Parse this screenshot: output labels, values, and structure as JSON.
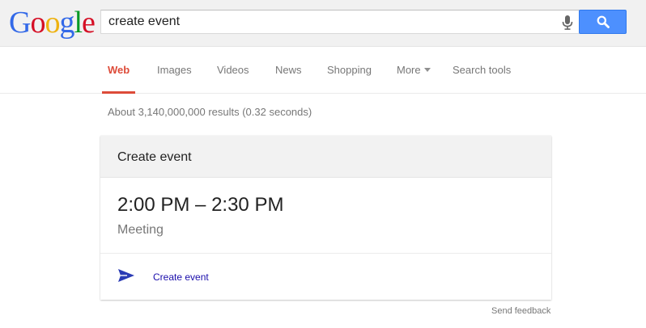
{
  "header": {
    "logo": [
      "G",
      "o",
      "o",
      "g",
      "l",
      "e"
    ],
    "logo_colors": [
      "#3369e8",
      "#d50f25",
      "#eeb211",
      "#3369e8",
      "#009925",
      "#d50f25"
    ],
    "search_value": "create event"
  },
  "tabs": [
    {
      "label": "Web",
      "active": true
    },
    {
      "label": "Images"
    },
    {
      "label": "Videos"
    },
    {
      "label": "News"
    },
    {
      "label": "Shopping"
    },
    {
      "label": "More"
    },
    {
      "label": "Search tools"
    }
  ],
  "result_stats": "About 3,140,000,000 results (0.32 seconds)",
  "card": {
    "title": "Create event",
    "time": "2:00 PM – 2:30 PM",
    "subtitle": "Meeting",
    "action_label": "Create event",
    "action_icon": "send-icon"
  },
  "footer": {
    "feedback": "Send feedback"
  },
  "colors": {
    "accent_red": "#dd4b39",
    "search_blue": "#4d90fe",
    "link_blue": "#1a0dab",
    "send_icon": "#2a3bb5"
  }
}
